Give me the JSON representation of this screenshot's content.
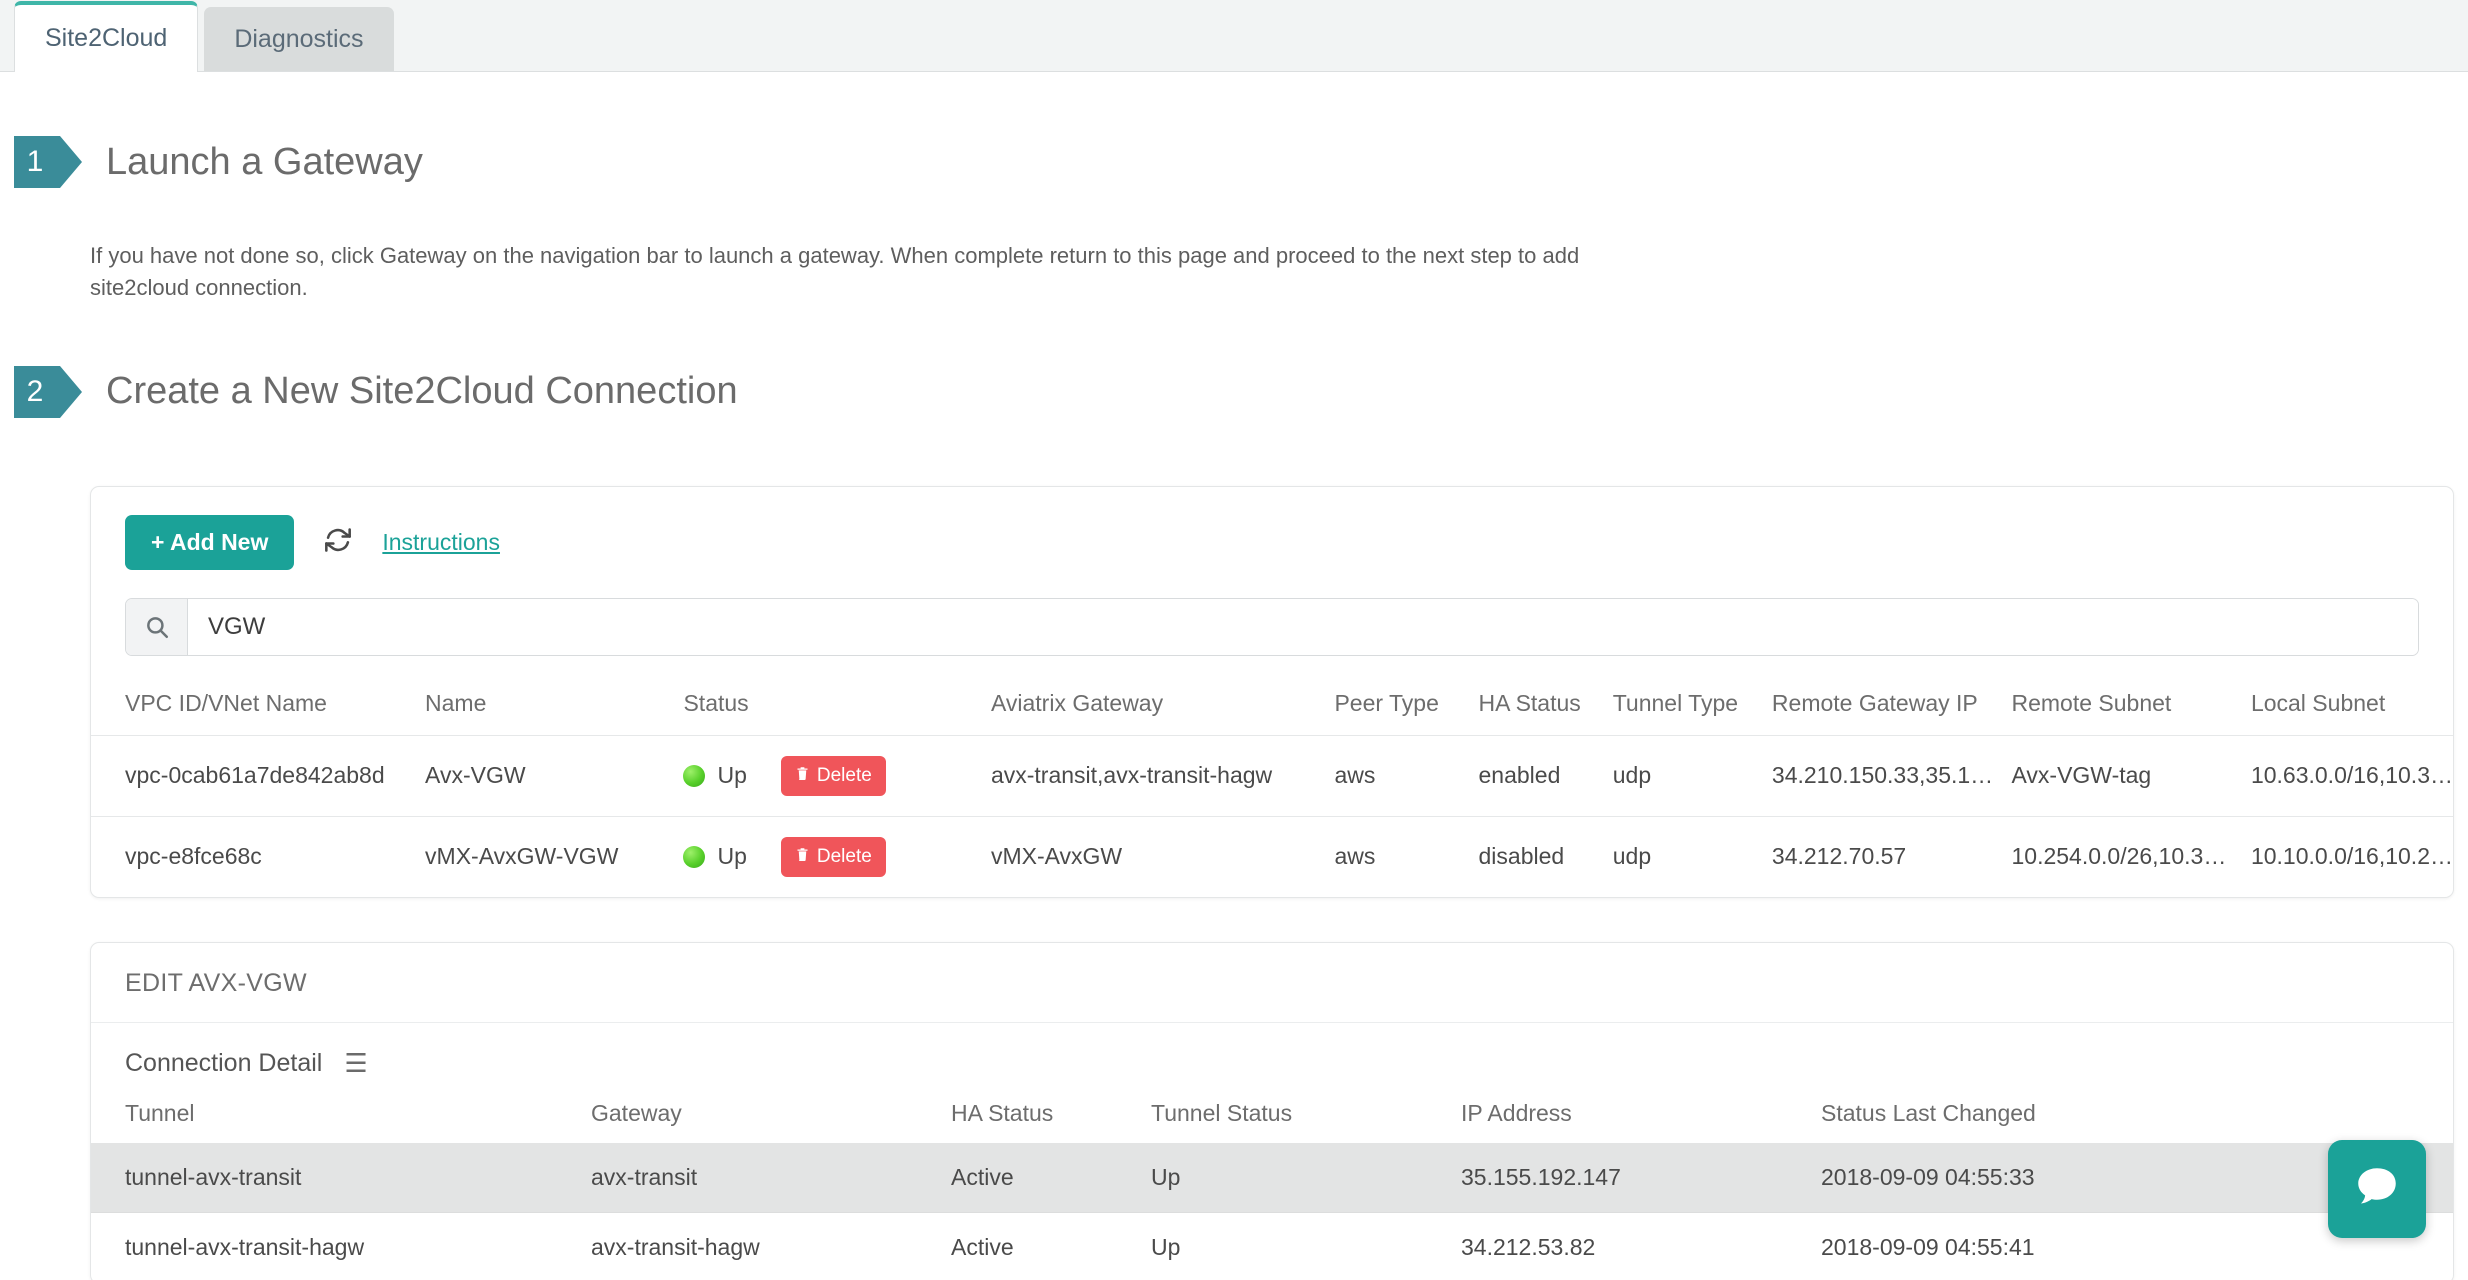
{
  "tabs": [
    {
      "label": "Site2Cloud",
      "active": true
    },
    {
      "label": "Diagnostics",
      "active": false
    }
  ],
  "steps": [
    {
      "number": "1",
      "title": "Launch a Gateway",
      "description": "If you have not done so, click Gateway on the navigation bar to launch a gateway. When complete return to this page and proceed to the next step to add site2cloud connection."
    },
    {
      "number": "2",
      "title": "Create a New Site2Cloud Connection"
    }
  ],
  "toolbar": {
    "add_new_label": "+ Add New",
    "refresh_icon": "refresh-icon",
    "instructions_label": "Instructions"
  },
  "search": {
    "icon": "search-icon",
    "value": "VGW",
    "placeholder": ""
  },
  "connections_table": {
    "columns": [
      "VPC ID/VNet Name",
      "Name",
      "Status",
      "Aviatrix Gateway",
      "Peer Type",
      "HA Status",
      "Tunnel Type",
      "Remote Gateway IP",
      "Remote Subnet",
      "Local Subnet"
    ],
    "delete_label": "Delete",
    "rows": [
      {
        "vpc_id": "vpc-0cab61a7de842ab8d",
        "name": "Avx-VGW",
        "status": "Up",
        "aviatrix_gateway": "avx-transit,avx-transit-hagw",
        "peer_type": "aws",
        "ha_status": "enabled",
        "tunnel_type": "udp",
        "remote_gateway_ip": "34.210.150.33,35.1…",
        "remote_subnet": "Avx-VGW-tag",
        "local_subnet": "10.63.0.0/16,10.3…"
      },
      {
        "vpc_id": "vpc-e8fce68c",
        "name": "vMX-AvxGW-VGW",
        "status": "Up",
        "aviatrix_gateway": "vMX-AvxGW",
        "peer_type": "aws",
        "ha_status": "disabled",
        "tunnel_type": "udp",
        "remote_gateway_ip": "34.212.70.57",
        "remote_subnet": "10.254.0.0/26,10.3…",
        "local_subnet": "10.10.0.0/16,10.2…"
      }
    ]
  },
  "edit_panel": {
    "title": "EDIT AVX-VGW",
    "connection_detail_label": "Connection Detail",
    "menu_icon": "hamburger-icon",
    "detail_table": {
      "columns": [
        "Tunnel",
        "Gateway",
        "HA Status",
        "Tunnel Status",
        "IP Address",
        "Status Last Changed"
      ],
      "rows": [
        {
          "tunnel": "tunnel-avx-transit",
          "gateway": "avx-transit",
          "ha_status": "Active",
          "tunnel_status": "Up",
          "ip_address": "35.155.192.147",
          "status_last_changed": "2018-09-09 04:55:33",
          "selected": true
        },
        {
          "tunnel": "tunnel-avx-transit-hagw",
          "gateway": "avx-transit-hagw",
          "ha_status": "Active",
          "tunnel_status": "Up",
          "ip_address": "34.212.53.82",
          "status_last_changed": "2018-09-09 04:55:41",
          "selected": false
        }
      ]
    }
  },
  "chat_widget": {
    "icon": "chat-bubble-icon"
  },
  "colors": {
    "accent_teal": "#1ba298",
    "step_badge": "#3a8c99",
    "tab_active_border": "#3fb6a8",
    "delete_red": "#f0555a",
    "status_green": "#57cf2a"
  }
}
